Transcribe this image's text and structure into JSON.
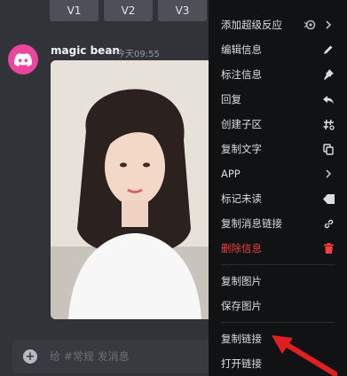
{
  "top_buttons": [
    "V1",
    "V2",
    "V3"
  ],
  "message": {
    "username": "magic bean",
    "timestamp": "今天09:55"
  },
  "composer": {
    "placeholder": "给 #常规 发消息"
  },
  "menu": {
    "items": [
      {
        "label": "添加超级反应",
        "icon": "super-reaction-icon",
        "has_submenu": true
      },
      {
        "label": "编辑信息",
        "icon": "pencil-icon"
      },
      {
        "label": "标注信息",
        "icon": "pin-icon"
      },
      {
        "label": "回复",
        "icon": "reply-icon"
      },
      {
        "label": "创建子区",
        "icon": "thread-icon"
      },
      {
        "label": "复制文字",
        "icon": "copy-icon"
      },
      {
        "label": "APP",
        "icon": "chevron-right-icon",
        "has_submenu": true
      },
      {
        "label": "标记未读",
        "icon": "mark-unread-icon"
      },
      {
        "label": "复制消息链接",
        "icon": "link-icon"
      },
      {
        "label": "删除信息",
        "icon": "trash-icon",
        "danger": true
      },
      {
        "label": "复制图片"
      },
      {
        "label": "保存图片"
      },
      {
        "label": "复制链接"
      },
      {
        "label": "打开链接"
      }
    ]
  },
  "colors": {
    "background": "#313338",
    "menu_background": "#111214",
    "danger": "#f23f43",
    "avatar": "#eb459e",
    "annotation_arrow": "#e02020"
  }
}
